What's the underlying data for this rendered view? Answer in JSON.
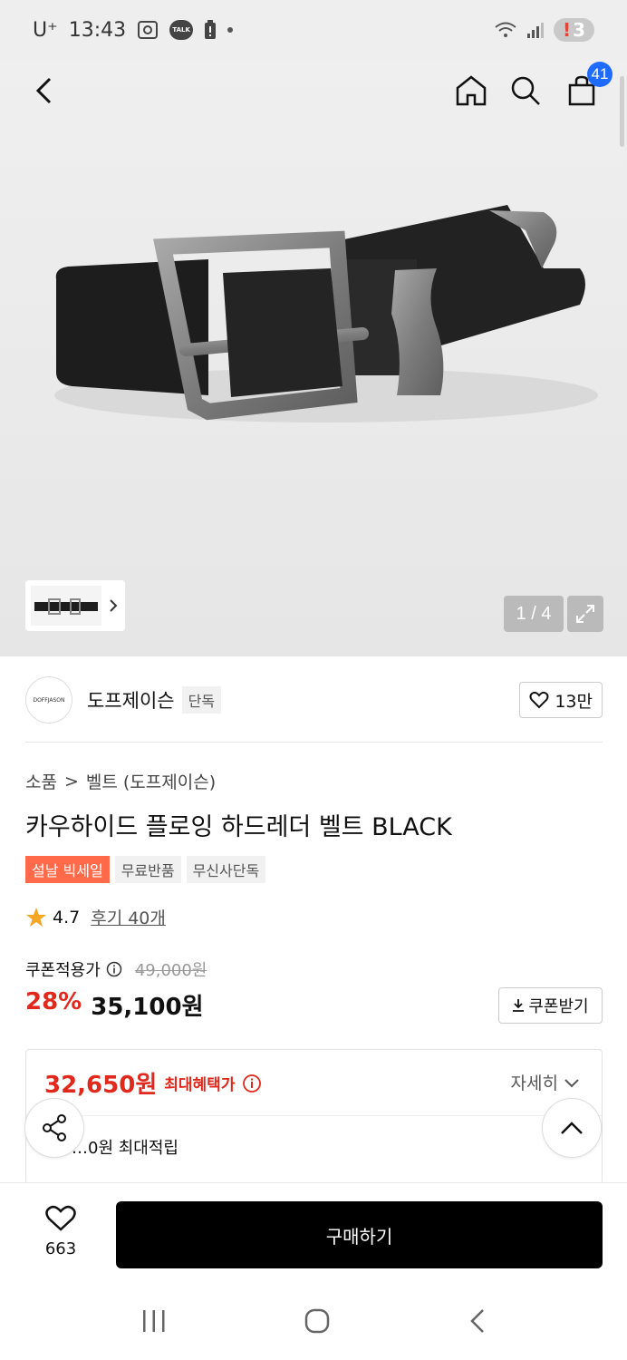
{
  "status_bar": {
    "carrier": "U⁺",
    "time": "13:43",
    "talk_label": "TALK",
    "badge_alert": "!",
    "badge_count": "3"
  },
  "nav": {
    "cart_count": "41"
  },
  "gallery": {
    "counter": "1 / 4"
  },
  "brand": {
    "logo_text": "DOFFJASON",
    "name": "도프제이슨",
    "exclusive_tag": "단독",
    "likes": "13만"
  },
  "breadcrumb": {
    "category": "소품",
    "separator": ">",
    "subcategory": "벨트 (도프제이슨)"
  },
  "product": {
    "title": "카우하이드 플로잉 하드레더 벨트 BLACK",
    "tags": [
      "설날 빅세일",
      "무료반품",
      "무신사단독"
    ],
    "rating": "4.7",
    "reviews": "후기 40개"
  },
  "price": {
    "coupon_label": "쿠폰적용가",
    "original": "49,000원",
    "discount": "28%",
    "sale": "35,100원",
    "coupon_button": "쿠폰받기"
  },
  "benefit": {
    "max_price": "32,650원",
    "max_label": "최대혜택가",
    "detail": "자세히",
    "points": "…0원 최대적립"
  },
  "bottom": {
    "wish_count": "663",
    "buy_label": "구매하기"
  },
  "colors": {
    "accent_red": "#e0281c",
    "sale_tag": "#ff6a4a",
    "cart_badge": "#1f6bff"
  }
}
